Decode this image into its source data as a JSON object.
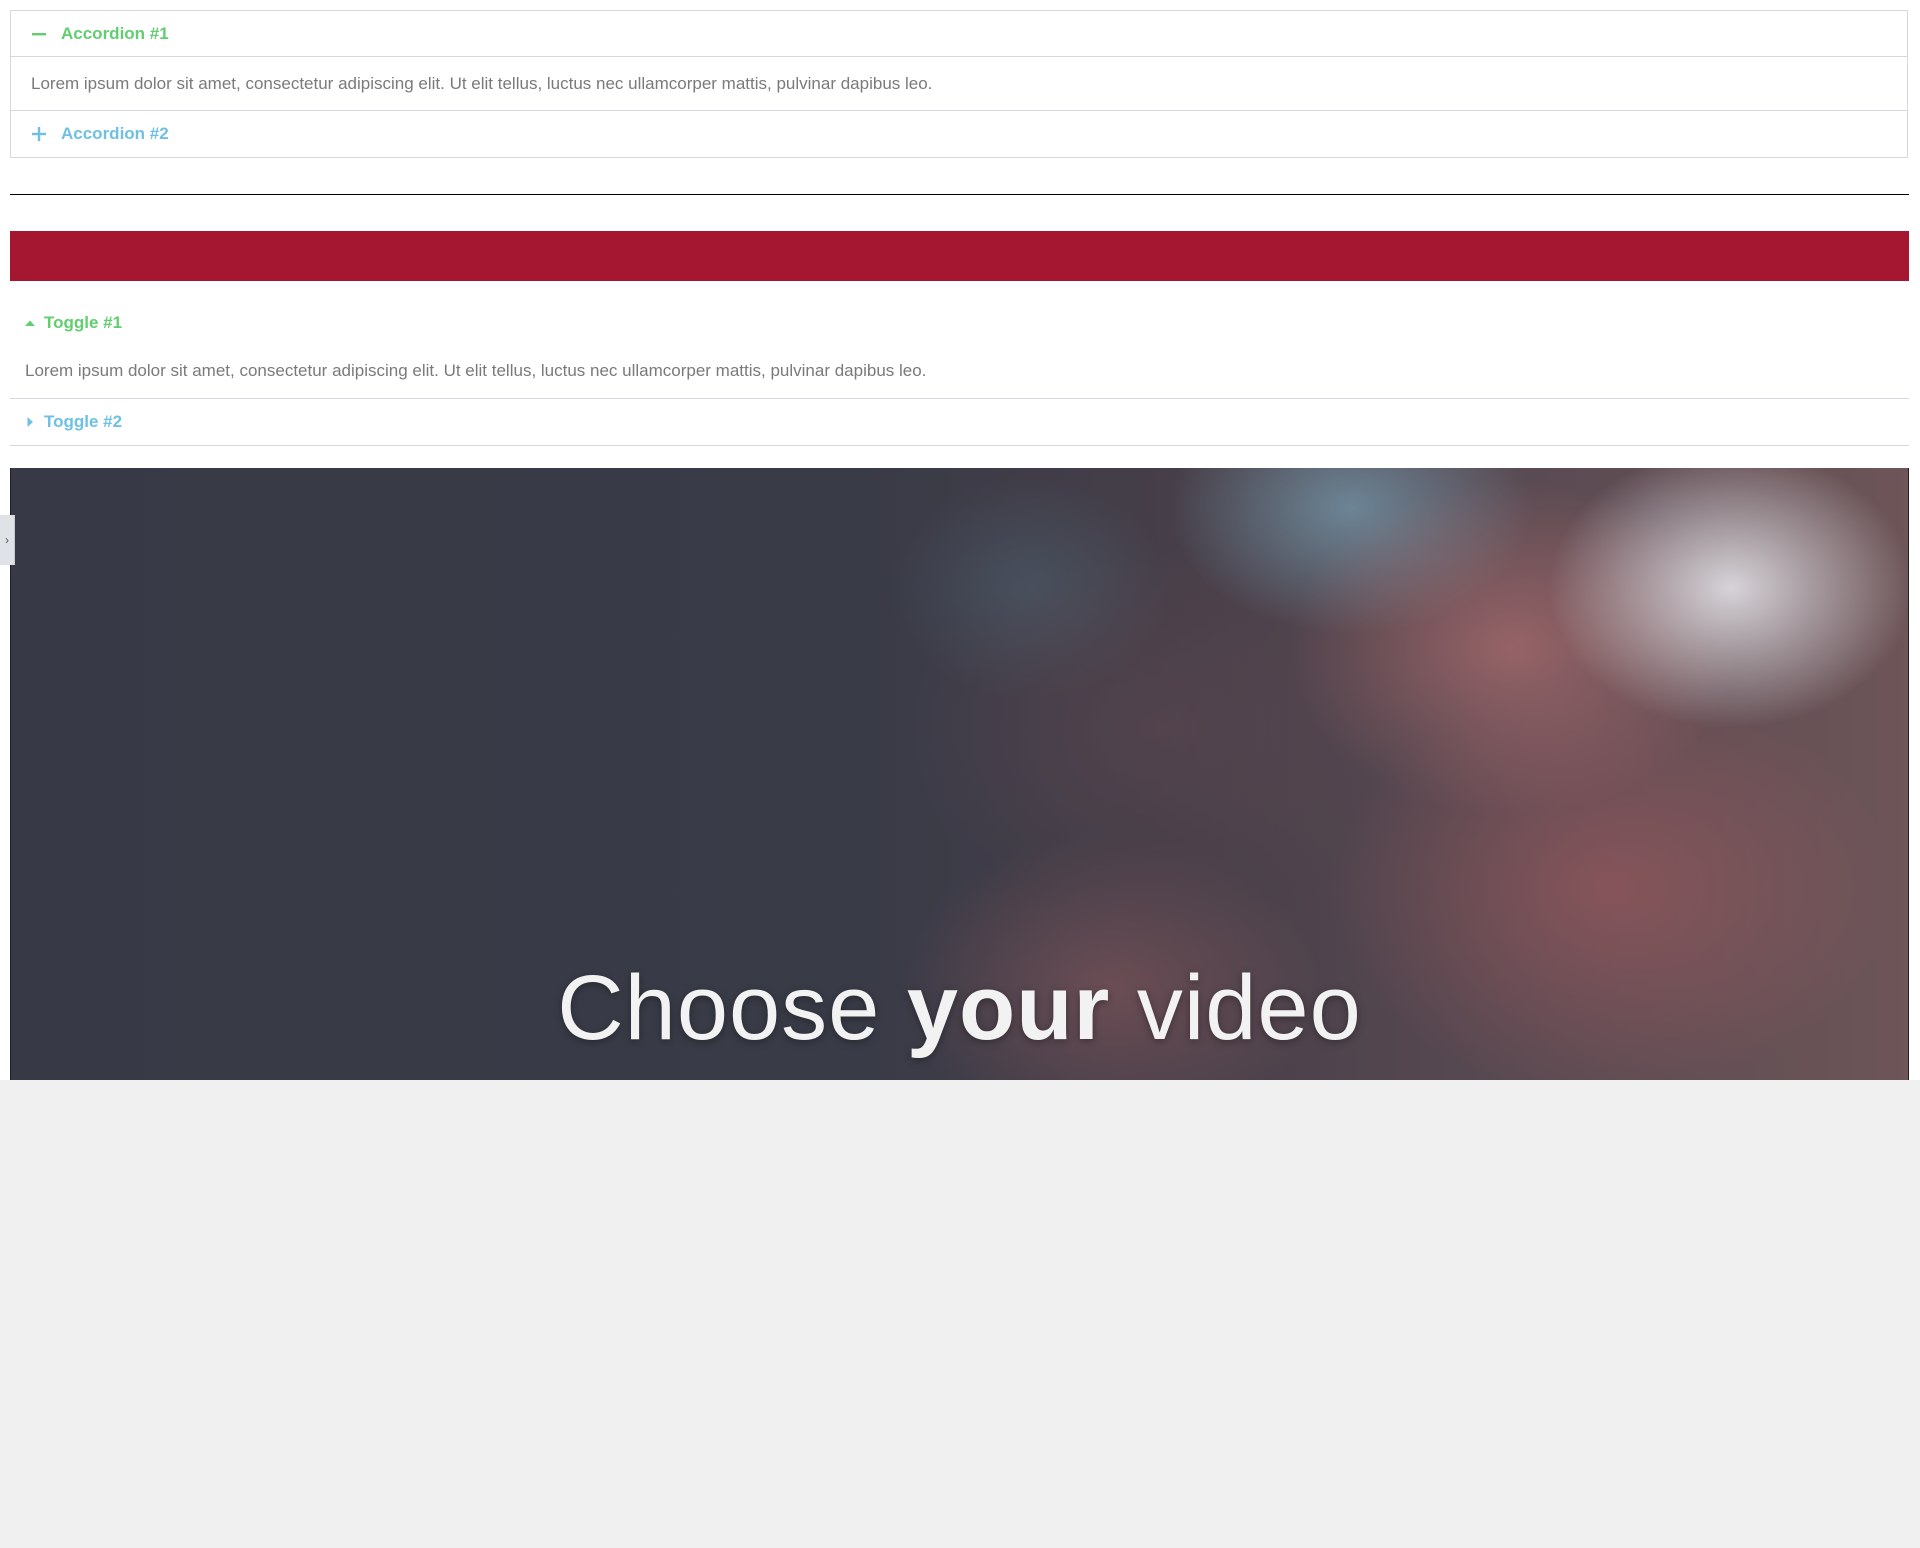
{
  "accordion": {
    "items": [
      {
        "title": "Accordion #1",
        "content": "Lorem ipsum dolor sit amet, consectetur adipiscing elit. Ut elit tellus, luctus nec ullamcorper mattis, pulvinar dapibus leo.",
        "expanded": true,
        "icon": "minus-icon"
      },
      {
        "title": "Accordion #2",
        "expanded": false,
        "icon": "plus-icon"
      }
    ]
  },
  "toggle": {
    "items": [
      {
        "title": "Toggle #1",
        "content": "Lorem ipsum dolor sit amet, consectetur adipiscing elit. Ut elit tellus, luctus nec ullamcorper mattis, pulvinar dapibus leo.",
        "expanded": true,
        "icon": "caret-up-icon"
      },
      {
        "title": "Toggle #2",
        "expanded": false,
        "icon": "caret-right-icon"
      }
    ]
  },
  "video": {
    "caption_pre": "Choose ",
    "caption_bold": "your",
    "caption_post": " video"
  },
  "colors": {
    "active": "#61ce70",
    "inactive": "#6ec1e4",
    "text": "#7a7a7a",
    "red_bar": "#a51731",
    "background": "#f0f0f0"
  },
  "side_tab": {
    "icon": "chevron-right-icon"
  }
}
